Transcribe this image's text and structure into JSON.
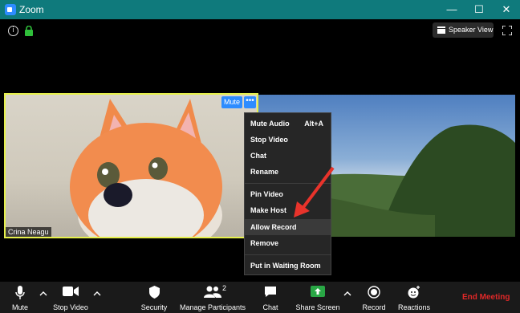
{
  "window": {
    "title": "Zoom",
    "minimize": "—",
    "maximize": "☐",
    "close": "✕"
  },
  "top": {
    "info_icon": "i",
    "speaker_view_label": "Speaker View"
  },
  "video": {
    "participant_name": "Crina Neagu",
    "mute_label": "Mute",
    "more_label": "•••"
  },
  "menu": {
    "items": [
      {
        "label": "Mute Audio",
        "shortcut": "Alt+A"
      },
      {
        "label": "Stop Video"
      },
      {
        "label": "Chat"
      },
      {
        "label": "Rename"
      },
      {
        "label": "Pin Video"
      },
      {
        "label": "Make Host"
      },
      {
        "label": "Allow Record"
      },
      {
        "label": "Remove"
      },
      {
        "label": "Put in Waiting Room"
      }
    ]
  },
  "toolbar": {
    "mute": "Mute",
    "stop_video": "Stop Video",
    "security": "Security",
    "manage_participants": "Manage Participants",
    "participant_count": "2",
    "chat": "Chat",
    "share_screen": "Share Screen",
    "record": "Record",
    "reactions": "Reactions",
    "end_meeting": "End Meeting"
  },
  "colors": {
    "titlebar": "#0f7a7c",
    "accent": "#2d8cff",
    "active_border": "#e6f04c",
    "end_meeting": "#e02828",
    "share_green": "#29a745"
  }
}
